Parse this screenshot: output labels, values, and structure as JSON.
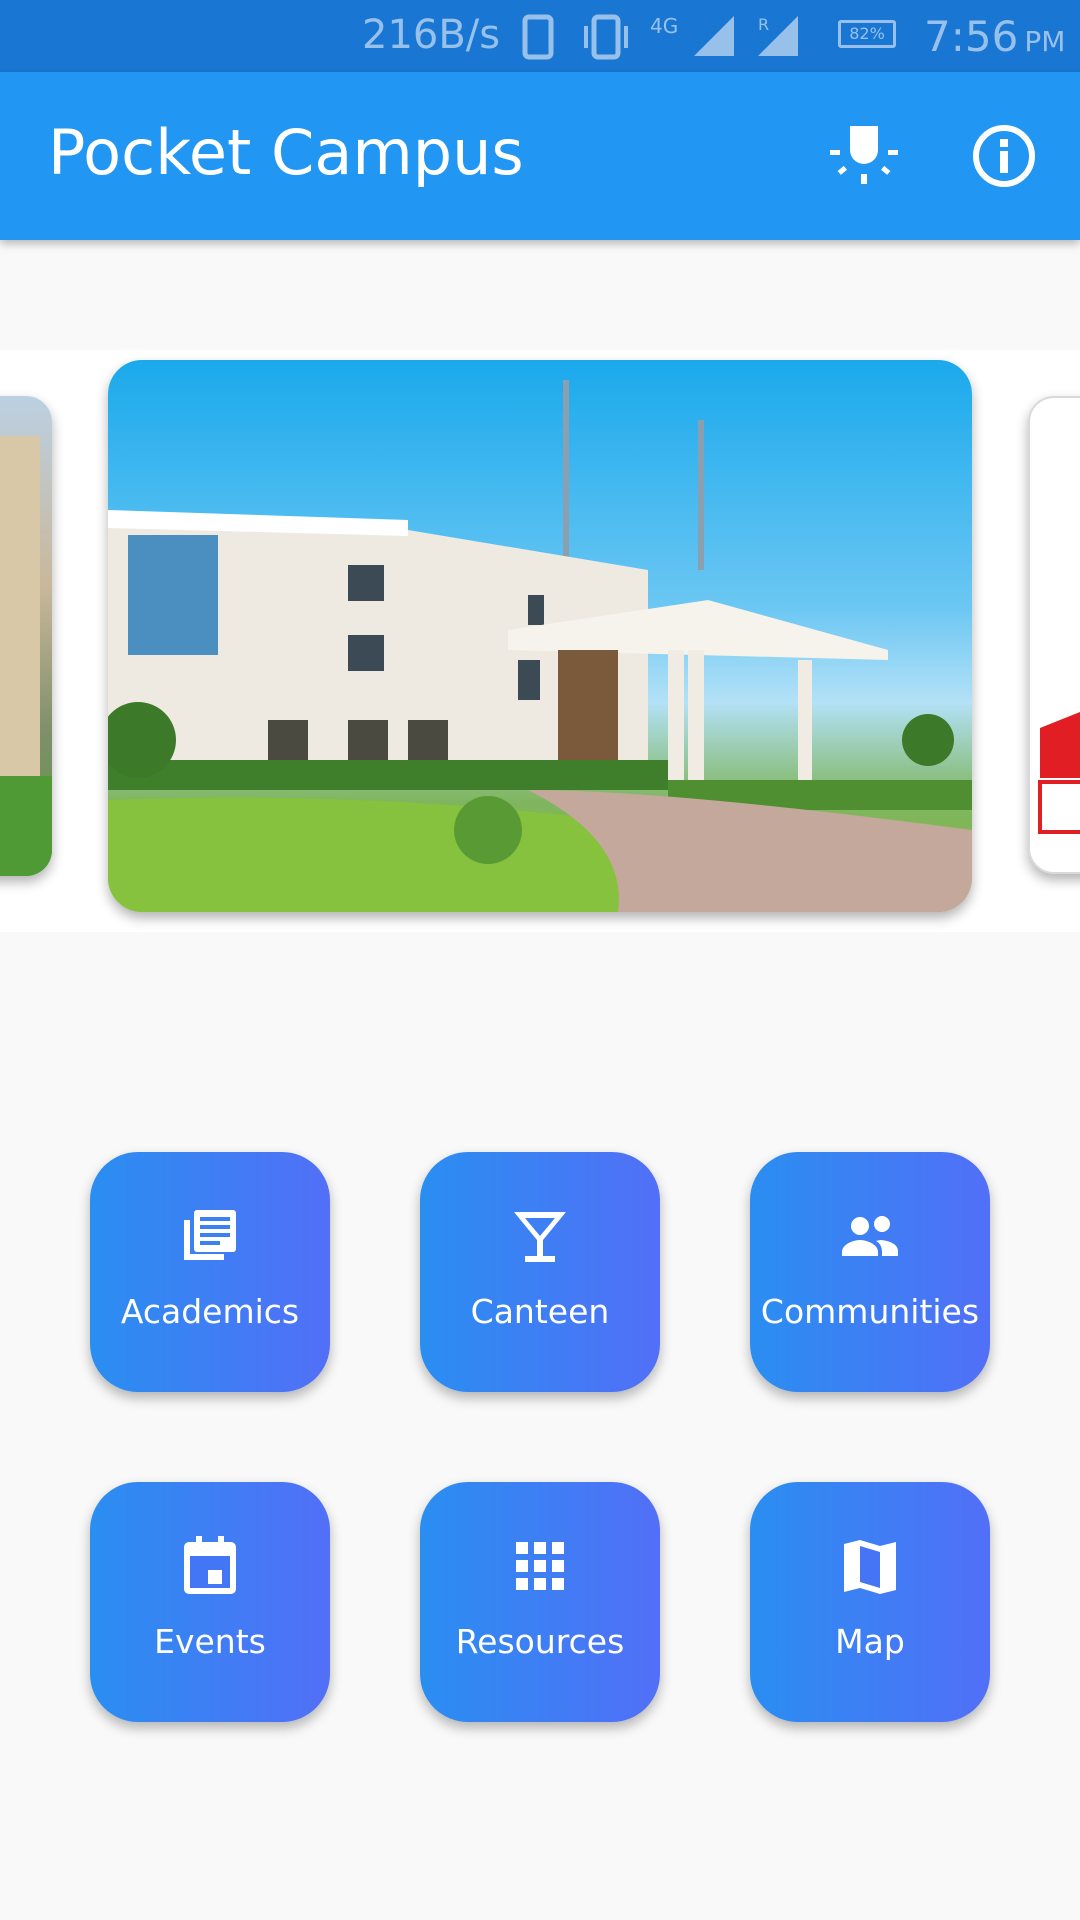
{
  "status_bar": {
    "net_speed": "216B/s",
    "network_type": "4G",
    "battery": "82%",
    "time": "7:56",
    "time_suffix": "PM"
  },
  "app_bar": {
    "title": "Pocket Campus",
    "actions": [
      {
        "icon": "lightbulb-icon"
      },
      {
        "icon": "info-icon"
      }
    ]
  },
  "carousel": {
    "slides": 3,
    "active_slide": 2
  },
  "tiles": [
    {
      "label": "Academics",
      "icon": "library-books-icon"
    },
    {
      "label": "Canteen",
      "icon": "cocktail-glass-icon"
    },
    {
      "label": "Communities",
      "icon": "people-icon"
    },
    {
      "label": "Events",
      "icon": "calendar-event-icon"
    },
    {
      "label": "Resources",
      "icon": "apps-grid-icon"
    },
    {
      "label": "Map",
      "icon": "map-icon"
    }
  ],
  "colors": {
    "status_bar": "#1976d2",
    "app_bar": "#2196f3",
    "tile_gradient_start": "#2a8ef1",
    "tile_gradient_end": "#526ff7",
    "background": "#f9f9f9"
  }
}
